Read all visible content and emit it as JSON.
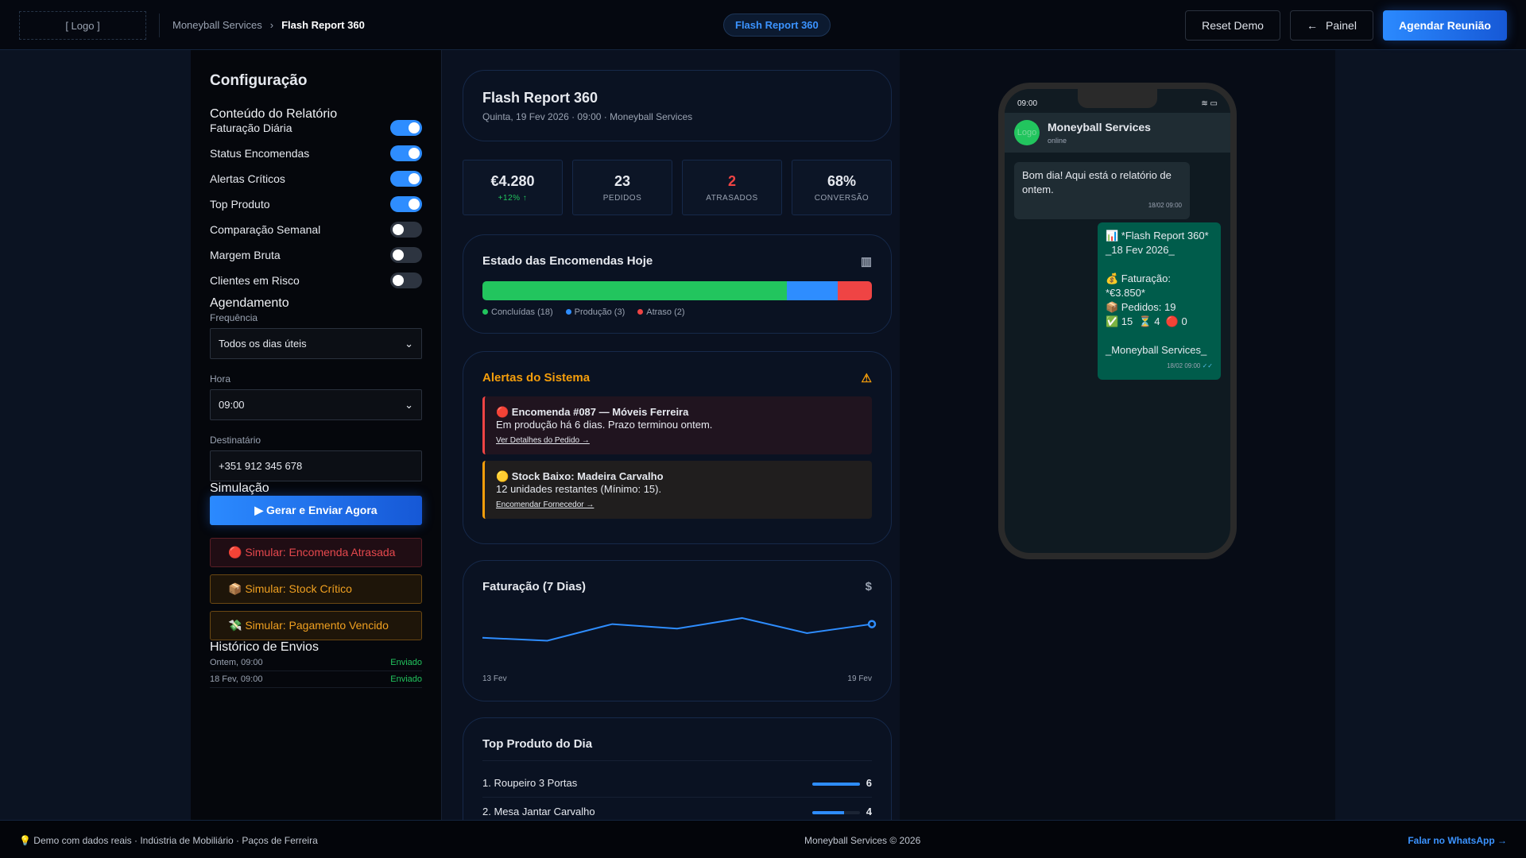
{
  "header": {
    "logo": "[ Logo ]",
    "breadcrumb": [
      "Moneyball Services",
      "Flash Report 360"
    ],
    "pill": "Flash Report 360",
    "reset": "Reset Demo",
    "painel": "Painel",
    "agendar": "Agendar Reunião"
  },
  "config": {
    "title": "Configuração",
    "content_title": "Conteúdo do Relatório",
    "toggles": [
      {
        "label": "Faturação Diária",
        "on": true
      },
      {
        "label": "Status Encomendas",
        "on": true
      },
      {
        "label": "Alertas Críticos",
        "on": true
      },
      {
        "label": "Top Produto",
        "on": true
      },
      {
        "label": "Comparação Semanal",
        "on": false
      },
      {
        "label": "Margem Bruta",
        "on": false
      },
      {
        "label": "Clientes em Risco",
        "on": false
      }
    ],
    "schedule_title": "Agendamento",
    "freq_label": "Frequência",
    "freq_value": "Todos os dias úteis",
    "hour_label": "Hora",
    "hour_value": "09:00",
    "dest_label": "Destinatário",
    "dest_value": "+351 912 345 678",
    "sim_title": "Simulação",
    "generate": "▶ Gerar e Enviar Agora",
    "sim_buttons": [
      "🔴 Simular: Encomenda Atrasada",
      "📦 Simular: Stock Crítico",
      "💸 Simular: Pagamento Vencido"
    ],
    "history_title": "Histórico de Envios",
    "history": [
      {
        "when": "Ontem, 09:00",
        "status": "Enviado"
      },
      {
        "when": "18 Fev, 09:00",
        "status": "Enviado"
      }
    ]
  },
  "report": {
    "title": "Flash Report 360",
    "subtitle": "Quinta, 19 Fev 2026 · 09:00 · Moneyball Services",
    "kpis": [
      {
        "value": "€4.280",
        "label": "",
        "delta": "+12% ↑"
      },
      {
        "value": "23",
        "label": "PEDIDOS"
      },
      {
        "value": "2",
        "label": "ATRASADOS"
      },
      {
        "value": "68%",
        "label": "CONVERSÃO"
      }
    ],
    "status_title": "Estado das Encomendas Hoje",
    "status": [
      {
        "label": "Concluídas (18)",
        "count": 18,
        "color": "#22c55e"
      },
      {
        "label": "Produção (3)",
        "count": 3,
        "color": "#2e8dff"
      },
      {
        "label": "Atraso (2)",
        "count": 2,
        "color": "#ef4444"
      }
    ],
    "alerts_title": "Alertas do Sistema",
    "alerts": [
      {
        "title": "🔴 Encomenda #087 — Móveis Ferreira",
        "text": "Em produção há 6 dias. Prazo terminou ontem.",
        "link": "Ver Detalhes do Pedido →"
      },
      {
        "title": "🟡 Stock Baixo: Madeira Carvalho",
        "text": "12 unidades restantes (Mínimo: 15).",
        "link": "Encomendar Fornecedor →"
      }
    ],
    "revenue_title": "Faturação (7 Dias)",
    "top_title": "Top Produto do Dia",
    "products": [
      {
        "name": "1. Roupeiro 3 Portas",
        "qty": 6
      },
      {
        "name": "2. Mesa Jantar Carvalho",
        "qty": 4
      }
    ]
  },
  "chart_data": {
    "type": "line",
    "title": "Faturação (7 Dias)",
    "x": [
      "13 Fev",
      "14 Fev",
      "15 Fev",
      "16 Fev",
      "17 Fev",
      "18 Fev",
      "19 Fev"
    ],
    "x_tick_labels": [
      "13 Fev",
      "19 Fev"
    ],
    "values": [
      3400,
      3300,
      3850,
      3700,
      4050,
      3550,
      3850
    ],
    "ylim": [
      2500,
      4600
    ]
  },
  "phone": {
    "time": "09:00",
    "contact": "Moneyball Services",
    "presence": "online",
    "avatar": "Logo",
    "messages": [
      {
        "text": "Bom dia! Aqui está o relatório de ontem.",
        "time": "18/02 09:00"
      },
      {
        "text": "📊 *Flash Report 360*\n_18 Fev 2026_\n\n💰 Faturação: *€3.850*\n📦 Pedidos: 19\n✅ 15  ⏳ 4  🔴 0\n\n_Moneyball Services_",
        "time": "18/02 09:00",
        "ticks": "✓✓"
      }
    ]
  },
  "footer": {
    "left": "💡 Demo com dados reais · Indústria de Mobiliário · Paços de Ferreira",
    "center": "Moneyball Services © 2026",
    "right": "Falar no WhatsApp →"
  }
}
